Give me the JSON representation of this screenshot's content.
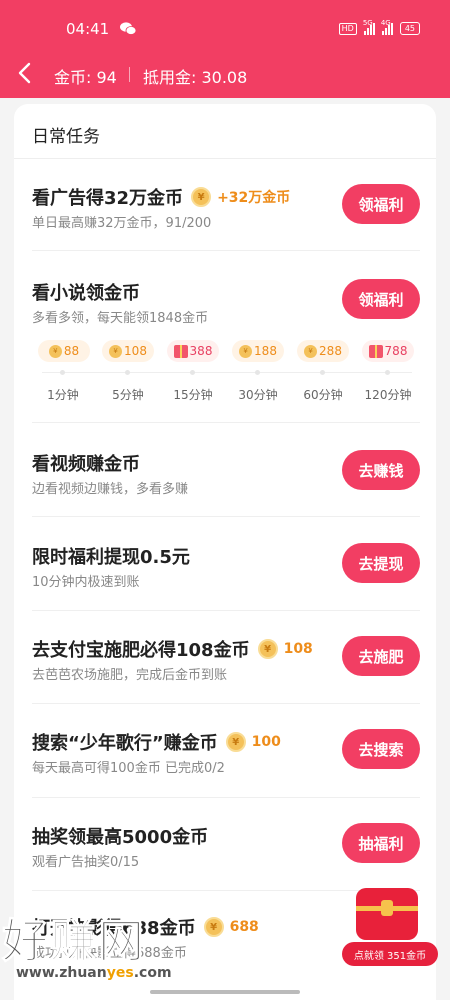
{
  "status_bar": {
    "time": "04:41",
    "hd": "HD",
    "sig1": "5G",
    "sig2": "4G",
    "battery": "45"
  },
  "header": {
    "coins_text": "金币: 94",
    "deduct_text": "抵用金: 30.08"
  },
  "section_title": "日常任务",
  "tasks": [
    {
      "title": "看广告得32万金币",
      "reward": "+32万金币",
      "subtitle": "单日最高赚32万金币，91/200",
      "button": "领福利"
    },
    {
      "title": "看小说领金币",
      "subtitle": "多看多领，每天能领1848金币",
      "button": "领福利"
    },
    {
      "title": "看视频赚金币",
      "subtitle": "边看视频边赚钱，多看多赚",
      "button": "去赚钱"
    },
    {
      "title": "限时福利提现0.5元",
      "subtitle": "10分钟内极速到账",
      "button": "去提现"
    },
    {
      "title": "去支付宝施肥必得108金币",
      "reward": "108",
      "subtitle": "去芭芭农场施肥，完成后金币到账",
      "button": "去施肥"
    },
    {
      "title": "搜索“少年歌行”赚金币",
      "reward": "100",
      "subtitle": "每天最高可得100金币 已完成0/2",
      "button": "去搜索"
    },
    {
      "title": "抽奖领最高5000金币",
      "subtitle": "观看广告抽奖0/15",
      "button": "抽福利"
    },
    {
      "title": "打开快影得688金币",
      "reward": "688",
      "subtitle": "成功打开快影立得688金币"
    }
  ],
  "timeline": [
    {
      "amount": "88",
      "icon": "coin-icon",
      "label": "1分钟"
    },
    {
      "amount": "108",
      "icon": "coin-icon",
      "label": "5分钟"
    },
    {
      "amount": "388",
      "icon": "gift-icon",
      "label": "15分钟"
    },
    {
      "amount": "188",
      "icon": "coin-icon",
      "label": "30分钟"
    },
    {
      "amount": "288",
      "icon": "coin-icon",
      "label": "60分钟"
    },
    {
      "amount": "788",
      "icon": "gift-icon",
      "label": "120分钟"
    }
  ],
  "float_button": "点就领 351金币",
  "watermark": {
    "big": "好赚网",
    "url_a": "www.zhuan",
    "url_b": "yes",
    "url_c": ".com"
  },
  "colors": {
    "brand": "#f23e63",
    "reward": "#ee8d1b",
    "coin": "#f4c15a"
  }
}
